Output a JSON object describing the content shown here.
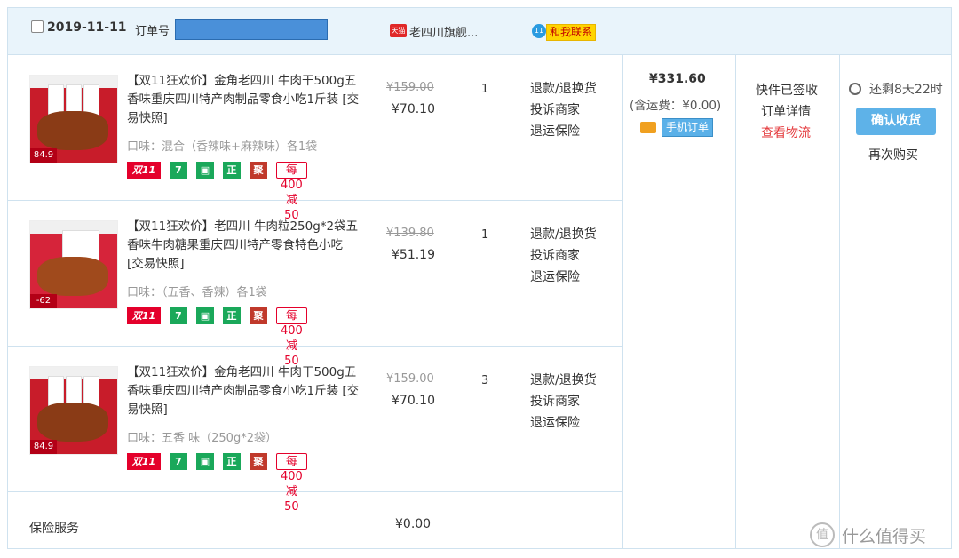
{
  "header": {
    "date": "2019-11-11",
    "order_label": "订单号",
    "tmall_badge": "天猫",
    "shop_name": "老四川旗舰...",
    "contact_icon": "11",
    "contact": "和我联系"
  },
  "items": [
    {
      "title": "【双11狂欢价】金角老四川 牛肉干500g五香味重庆四川特产肉制品零食小吃1斤装 [交易快照]",
      "spec": "口味：混合（香辣味+麻辣味）各1袋",
      "thumb_price": "84.9",
      "original_price": "¥159.00",
      "price": "¥70.10",
      "qty": "1",
      "ops": [
        "退款/退换货",
        "投诉商家",
        "退运保险"
      ]
    },
    {
      "title": "【双11狂欢价】老四川 牛肉粒250g*2袋五香味牛肉糖果重庆四川特产零食特色小吃 [交易快照]",
      "spec": "口味：（五香、香辣）各1袋",
      "thumb_price": "-62",
      "original_price": "¥139.80",
      "price": "¥51.19",
      "qty": "1",
      "ops": [
        "退款/退换货",
        "投诉商家",
        "退运保险"
      ]
    },
    {
      "title": "【双11狂欢价】金角老四川 牛肉干500g五香味重庆四川特产肉制品零食小吃1斤装 [交易快照]",
      "spec": "口味：五香 味（250g*2袋）",
      "thumb_price": "84.9",
      "original_price": "¥159.00",
      "price": "¥70.10",
      "qty": "3",
      "ops": [
        "退款/退换货",
        "投诉商家",
        "退运保险"
      ]
    }
  ],
  "tags": {
    "double11": "双11",
    "seven": "7",
    "bag_icon": "shopping-bag-icon",
    "zheng": "正",
    "ju": "聚",
    "discount": "每400减50"
  },
  "summary": {
    "total": "¥331.60",
    "shipping": "(含运费：¥0.00)",
    "mobile_order": "手机订单",
    "status": "快件已签收",
    "detail": "订单详情",
    "logistics": "查看物流",
    "timer": "还剩8天22时",
    "confirm": "确认收货",
    "rebuy": "再次购买"
  },
  "insurance": {
    "label": "保险服务",
    "price": "¥0.00"
  },
  "watermark": {
    "logo": "值",
    "text": "什么值得买"
  }
}
